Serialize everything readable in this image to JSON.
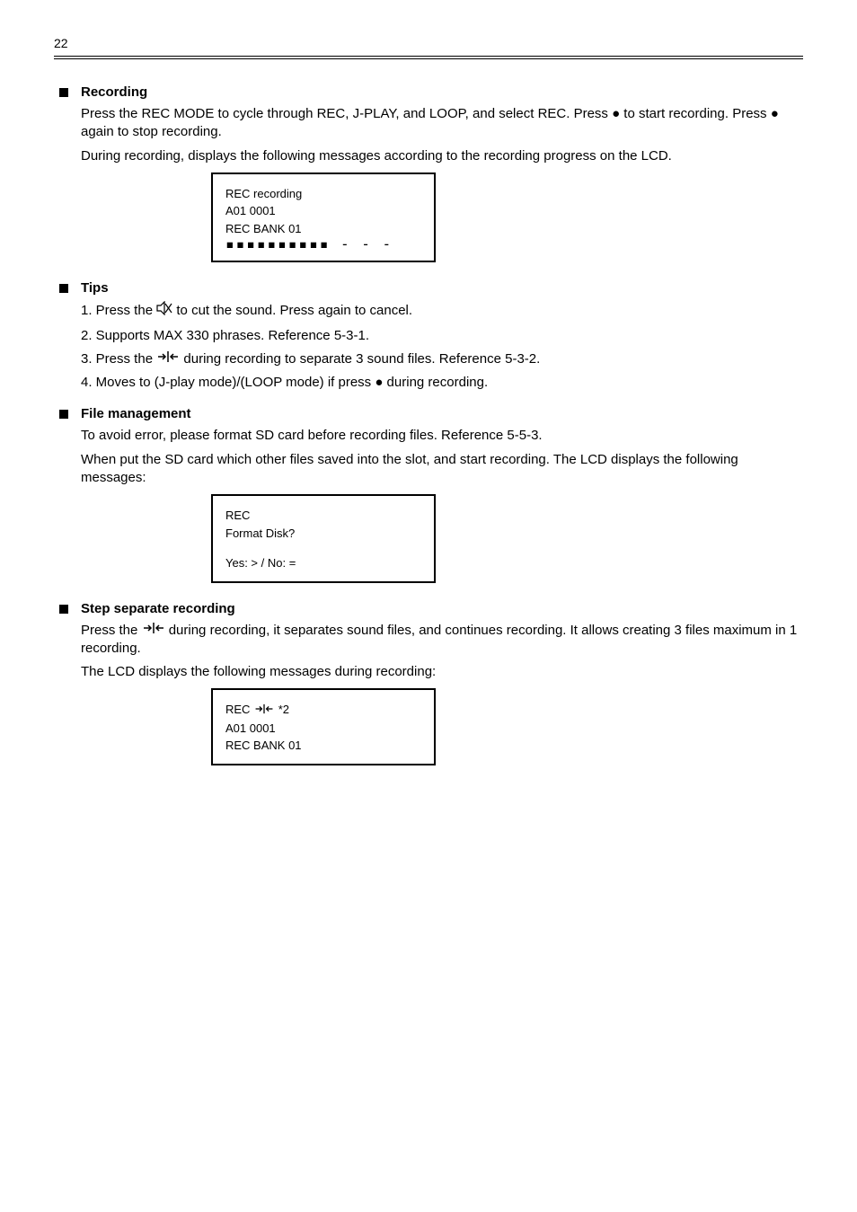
{
  "pageNumber": "22",
  "sections": [
    {
      "title": "Recording",
      "paras": [
        "Press the REC MODE to cycle through REC, J-PLAY, and LOOP, and select REC. Press ● to start recording. Press ● again to stop recording.",
        "During recording, displays the following messages according to the recording progress on the LCD."
      ],
      "lcd": {
        "lines": [
          "REC recording",
          "A01 0001",
          "REC BANK 01"
        ],
        "bar": "▪▪▪▪▪▪▪▪▪▪ - - -"
      }
    },
    {
      "title": "Tips",
      "paras": [
        "1. Press the {mute} to cut the sound. Press again to cancel.",
        "2. Supports MAX 330 phrases. Reference 5-3-1.",
        "3. Press the {step} during recording to separate 3 sound files. Reference 5-3-2.",
        "4. Moves to (J-play mode)/(LOOP mode) if press ● during recording."
      ]
    },
    {
      "title": "File management",
      "paras": [
        "To avoid error, please format SD card before recording files. Reference 5-5-3.",
        "When put the SD card which other files saved into the slot, and start recording. The LCD displays the following messages:"
      ],
      "lcd": {
        "lines": [
          "REC",
          "Format Disk?",
          "Yes: > / No: ="
        ]
      }
    },
    {
      "title": "Step separate recording",
      "paras": [
        "Press the {step} during recording, it separates sound files, and continues recording. It allows creating 3 files maximum in 1 recording.",
        "The LCD displays the following messages during recording:"
      ],
      "lcd": {
        "lines": [
          "REC {step} *2",
          "A01 0001",
          "REC BANK 01"
        ]
      }
    }
  ],
  "icons": {
    "mute": "mute-icon",
    "step": "step-icon"
  }
}
